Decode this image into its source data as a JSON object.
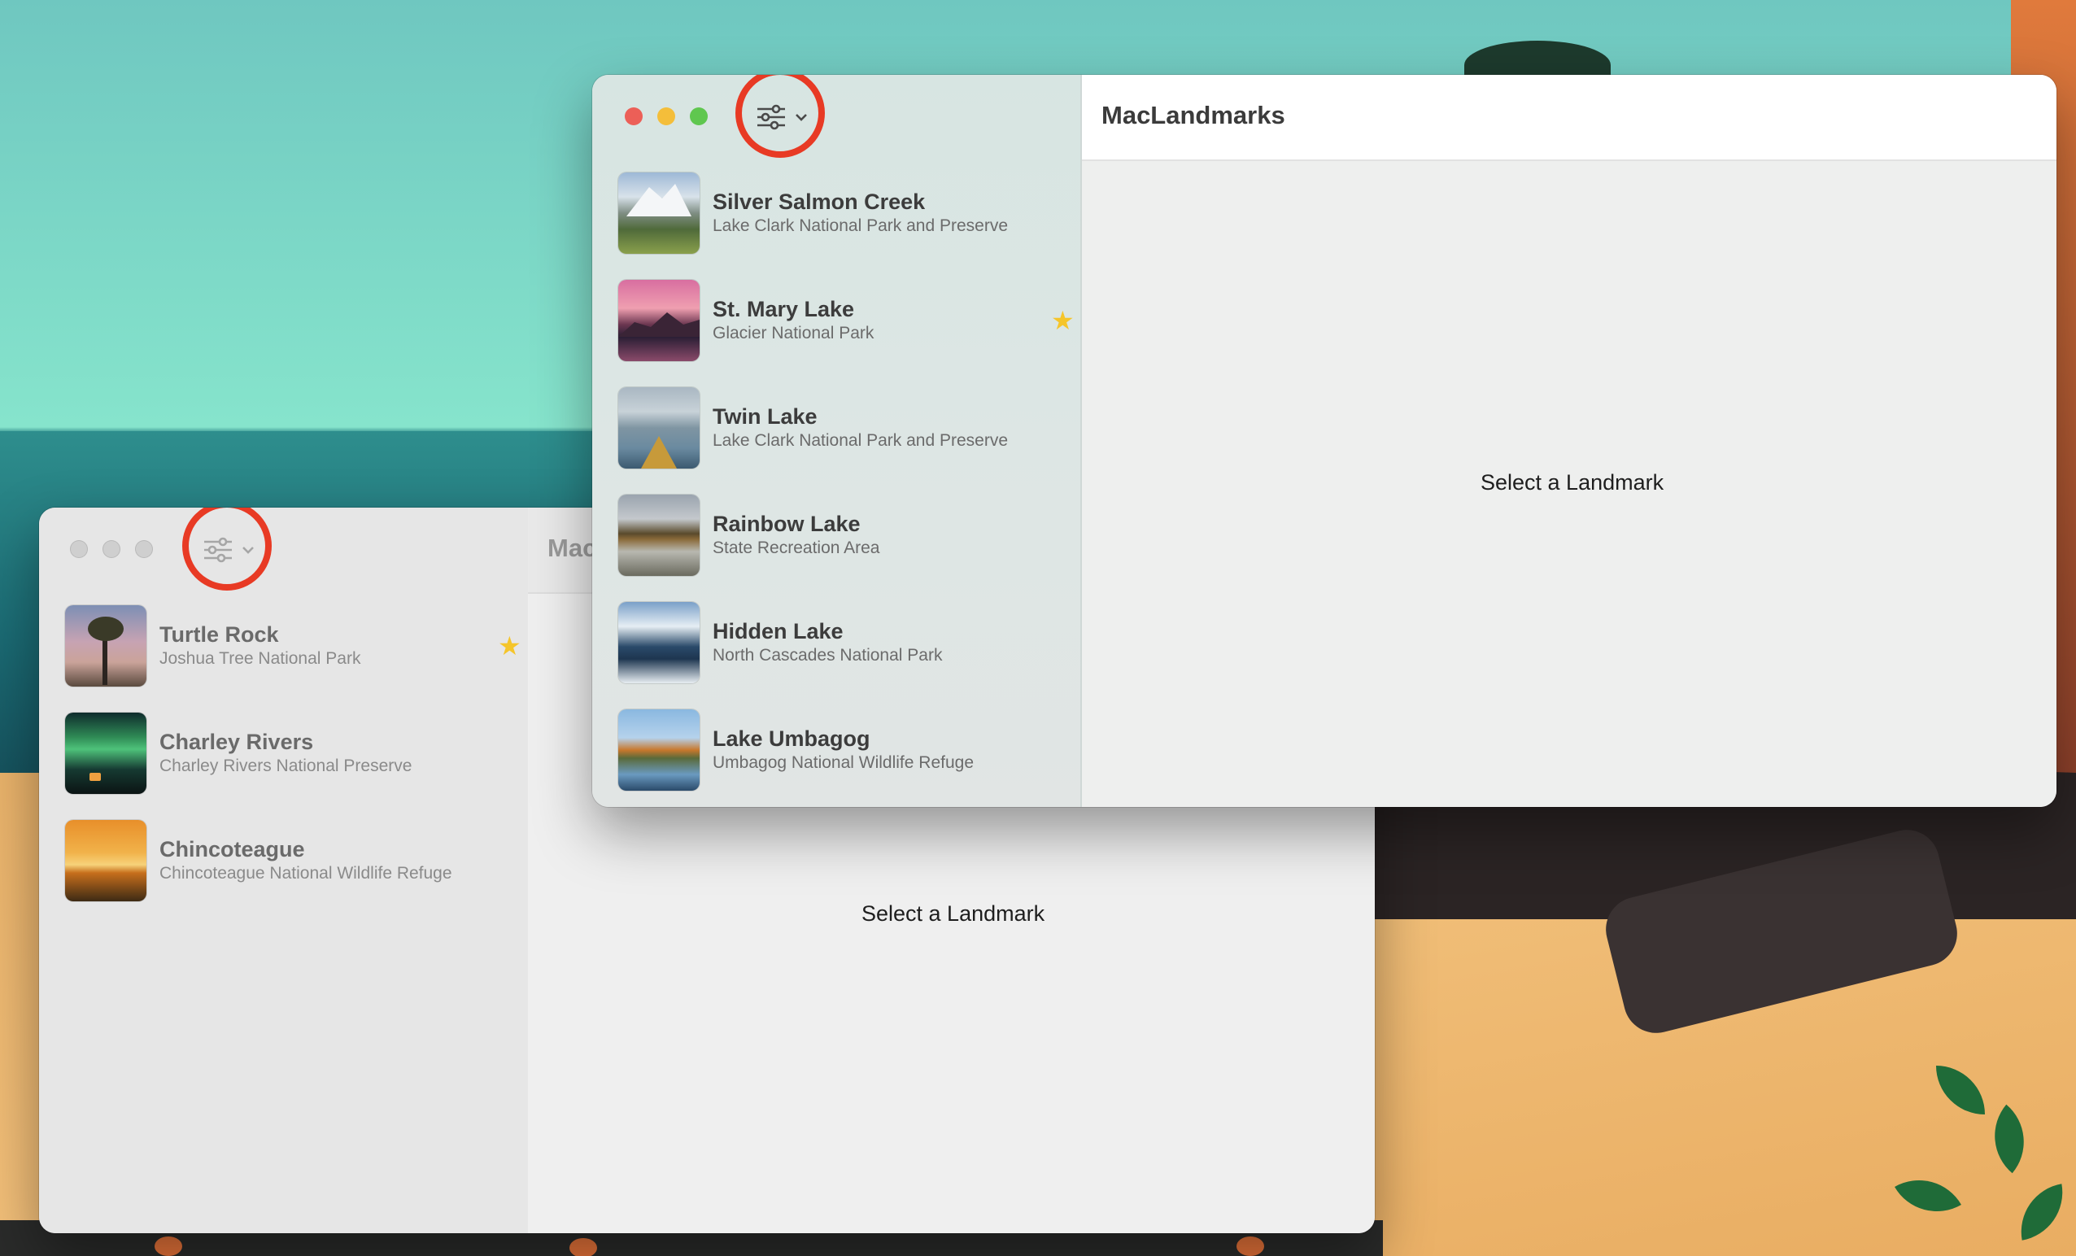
{
  "back_window": {
    "title_fragment": "Mac",
    "placeholder": "Select a Landmark",
    "landmarks": [
      {
        "name": "Turtle Rock",
        "park": "Joshua Tree National Park",
        "favorite": true
      },
      {
        "name": "Charley Rivers",
        "park": "Charley Rivers National Preserve",
        "favorite": false
      },
      {
        "name": "Chincoteague",
        "park": "Chincoteague National Wildlife Refuge",
        "favorite": false
      }
    ]
  },
  "front_window": {
    "title": "MacLandmarks",
    "placeholder": "Select a Landmark",
    "landmarks": [
      {
        "name": "Silver Salmon Creek",
        "park": "Lake Clark National Park and Preserve",
        "favorite": false
      },
      {
        "name": "St. Mary Lake",
        "park": "Glacier National Park",
        "favorite": true
      },
      {
        "name": "Twin Lake",
        "park": "Lake Clark National Park and Preserve",
        "favorite": false
      },
      {
        "name": "Rainbow Lake",
        "park": "State Recreation Area",
        "favorite": false
      },
      {
        "name": "Hidden Lake",
        "park": "North Cascades National Park",
        "favorite": false
      },
      {
        "name": "Lake Umbagog",
        "park": "Umbagog National Wildlife Refuge",
        "favorite": false
      }
    ]
  },
  "icons": {
    "filter": "sliders-icon",
    "chevron": "chevron-down-icon",
    "favorite": "star-icon"
  },
  "colors": {
    "close": "#ec5f57",
    "minimize": "#f4be3a",
    "zoom": "#5fc74f",
    "favorite": "#f5c52a",
    "highlight_ring": "#e83a24",
    "star_glyph": "★"
  }
}
